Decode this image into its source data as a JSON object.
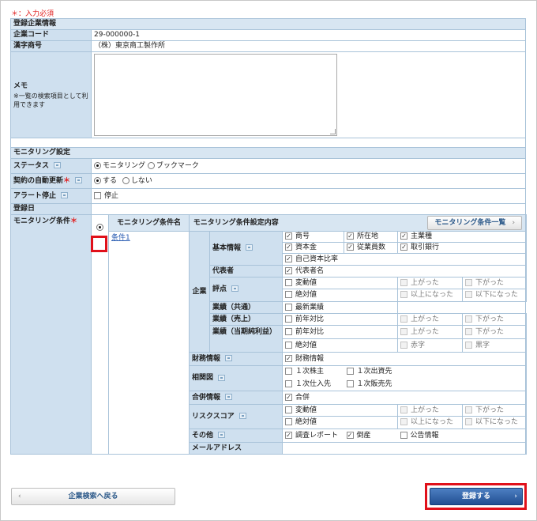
{
  "required_note": "＊：入力必須",
  "company": {
    "section": "登録企業情報",
    "code_label": "企業コード",
    "code_value": "29-000000-1",
    "name_label": "漢字商号",
    "name_value": "（株）東京商工製作所",
    "memo_label": "メモ",
    "memo_hint": "※一覧の検索項目として利用できます",
    "memo_value": ""
  },
  "monitoring": {
    "section": "モニタリング設定",
    "status_label": "ステータス",
    "status_options": [
      "モニタリング",
      "ブックマーク"
    ],
    "status_selected": "モニタリング",
    "auto_renew_label": "契約の自動更新",
    "auto_renew_star": "＊",
    "auto_renew_options": [
      "する",
      "しない"
    ],
    "alert_label": "アラート停止",
    "alert_option": "停止",
    "reg_date_label": "登録日",
    "cond_label": "モニタリング条件",
    "cond_star": "＊",
    "cond_name_header": "モニタリング条件名",
    "cond_content_header": "モニタリング条件設定内容",
    "cond_list_button": "モニタリング条件一覧",
    "cond_name": "条件1",
    "company_group_label": "企業",
    "rows": {
      "basic": {
        "label": "基本情報",
        "items": [
          "商号",
          "所在地",
          "主業種",
          "資本金",
          "従業員数",
          "取引銀行",
          "自己資本比率"
        ]
      },
      "rep": {
        "label": "代表者",
        "items": [
          "代表者名"
        ]
      },
      "rating": {
        "label": "評点",
        "items": [
          "変動値",
          "上がった",
          "下がった",
          "絶対値",
          "以上になった",
          "以下になった"
        ]
      },
      "perf_total": {
        "label": "業績（共通）",
        "items": [
          "最新業績"
        ]
      },
      "perf_sales": {
        "label": "業績（売上）",
        "items": [
          "前年対比",
          "上がった",
          "下がった"
        ]
      },
      "perf_profit": {
        "label": "業績（当期純利益）",
        "items": [
          "前年対比",
          "上がった",
          "下がった",
          "絶対値",
          "赤字",
          "黒字"
        ]
      },
      "finance": {
        "label": "財務情報",
        "items": [
          "財務情報"
        ]
      },
      "relation": {
        "label": "相関図",
        "items": [
          "１次株主",
          "１次出資先",
          "１次仕入先",
          "１次販売先"
        ]
      },
      "merger": {
        "label": "合併情報",
        "items": [
          "合併"
        ]
      },
      "risk": {
        "label": "リスクスコア",
        "items": [
          "変動値",
          "上がった",
          "下がった",
          "絶対値",
          "以上になった",
          "以下になった"
        ]
      },
      "other": {
        "label": "その他",
        "items": [
          "調査レポート",
          "倒産",
          "公告情報"
        ]
      },
      "mail": {
        "label": "メールアドレス",
        "value": ""
      }
    }
  },
  "buttons": {
    "back": "企業検索へ戻る",
    "register": "登録する"
  },
  "colors": {
    "required": "#e02020",
    "header_bg": "#d8e6f2",
    "label_bg": "#cfe0ef",
    "border": "#a9c3d9",
    "primary_button": "#2f5ea3",
    "highlight": "#e0101a"
  }
}
